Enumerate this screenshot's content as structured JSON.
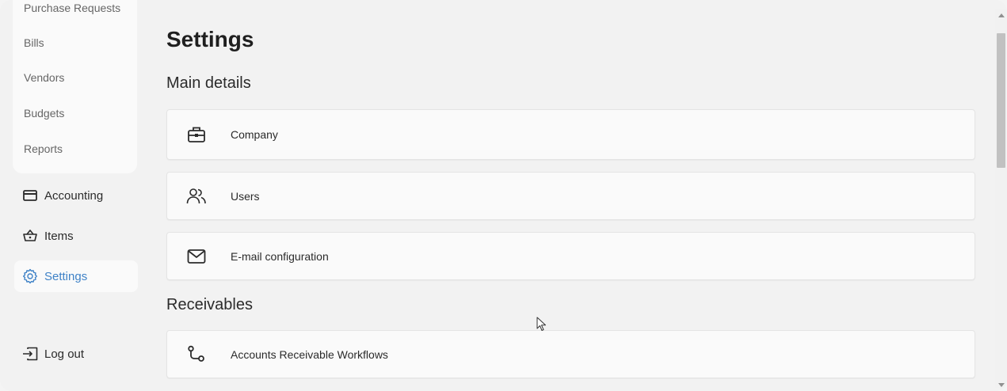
{
  "sidebar": {
    "sub_items": [
      {
        "label": "Purchase Requests"
      },
      {
        "label": "Bills"
      },
      {
        "label": "Vendors"
      },
      {
        "label": "Budgets"
      },
      {
        "label": "Reports"
      }
    ],
    "nav_items": [
      {
        "label": "Accounting",
        "icon": "credit-card-icon"
      },
      {
        "label": "Items",
        "icon": "basket-icon"
      },
      {
        "label": "Settings",
        "icon": "gear-icon",
        "active": true
      }
    ],
    "logout_label": "Log out",
    "active_color": "#3f82c7"
  },
  "main": {
    "title": "Settings",
    "sections": [
      {
        "title": "Main details",
        "cards": [
          {
            "label": "Company",
            "icon": "briefcase-icon"
          },
          {
            "label": "Users",
            "icon": "users-icon"
          },
          {
            "label": "E-mail configuration",
            "icon": "mail-icon"
          }
        ]
      },
      {
        "title": "Receivables",
        "cards": [
          {
            "label": "Accounts Receivable Workflows",
            "icon": "workflow-icon"
          }
        ]
      }
    ]
  }
}
